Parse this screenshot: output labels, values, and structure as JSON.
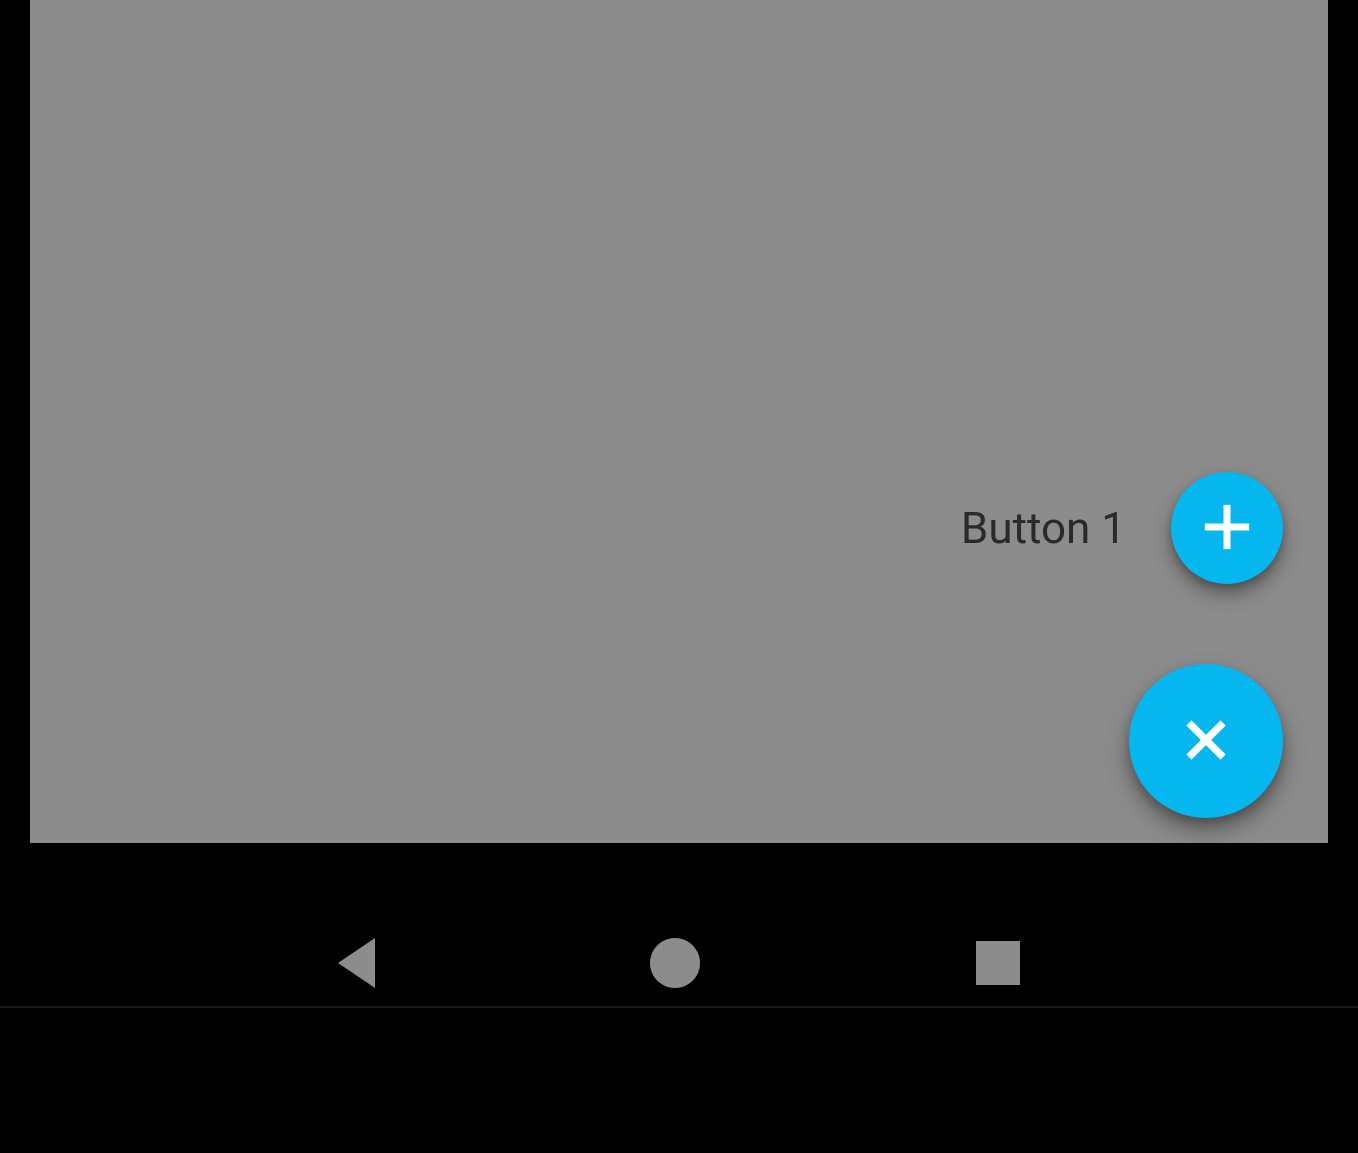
{
  "fab": {
    "actions": [
      {
        "label": "Button 1",
        "icon": "plus"
      }
    ],
    "main_icon": "close"
  },
  "colors": {
    "accent": "#06b6ef",
    "surface": "#8c8c8c",
    "frame": "#000000"
  }
}
